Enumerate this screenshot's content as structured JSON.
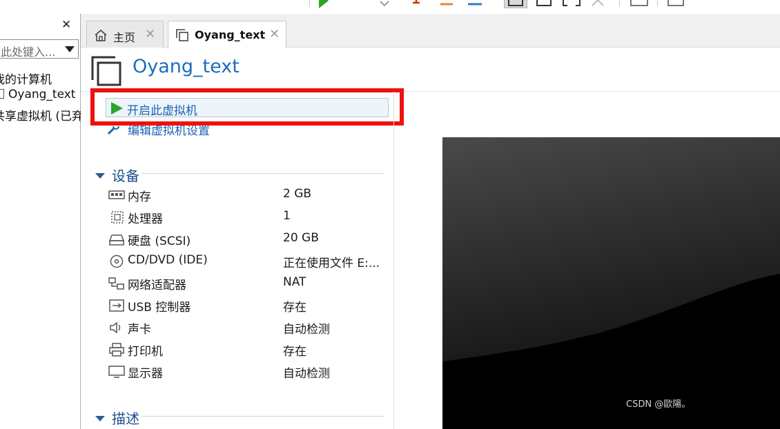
{
  "tabs": [
    {
      "label": "主页"
    },
    {
      "label": "Oyang_text"
    }
  ],
  "sidebar": {
    "search_placeholder": "在此处键入...",
    "tree": [
      {
        "label": "我的计算机"
      },
      {
        "label": "Oyang_text"
      },
      {
        "label": "共享虚拟机 (已弃用)"
      }
    ]
  },
  "vm": {
    "title": "Oyang_text",
    "power_on_label": "开启此虚拟机",
    "edit_settings_label": "编辑虚拟机设置"
  },
  "devices_section": {
    "title": "设备",
    "devices": [
      {
        "name": "内存",
        "value": "2 GB",
        "icon": "memory-icon"
      },
      {
        "name": "处理器",
        "value": "1",
        "icon": "processor-icon"
      },
      {
        "name": "硬盘 (SCSI)",
        "value": "20 GB",
        "icon": "hard-disk-icon"
      },
      {
        "name": "CD/DVD (IDE)",
        "value": "正在使用文件 E:...",
        "icon": "cd-dvd-icon"
      },
      {
        "name": "网络适配器",
        "value": "NAT",
        "icon": "network-adapter-icon"
      },
      {
        "name": "USB 控制器",
        "value": "存在",
        "icon": "usb-icon"
      },
      {
        "name": "声卡",
        "value": "自动检测",
        "icon": "speaker-icon"
      },
      {
        "name": "打印机",
        "value": "存在",
        "icon": "printer-icon"
      },
      {
        "name": "显示器",
        "value": "自动检测",
        "icon": "monitor-icon"
      }
    ]
  },
  "description_section": {
    "title": "描述"
  },
  "watermark": "CSDN @歐陽。",
  "colors": {
    "accent": "#1a6dbf",
    "highlight": "#ee1111",
    "play": "#2aa52a"
  }
}
